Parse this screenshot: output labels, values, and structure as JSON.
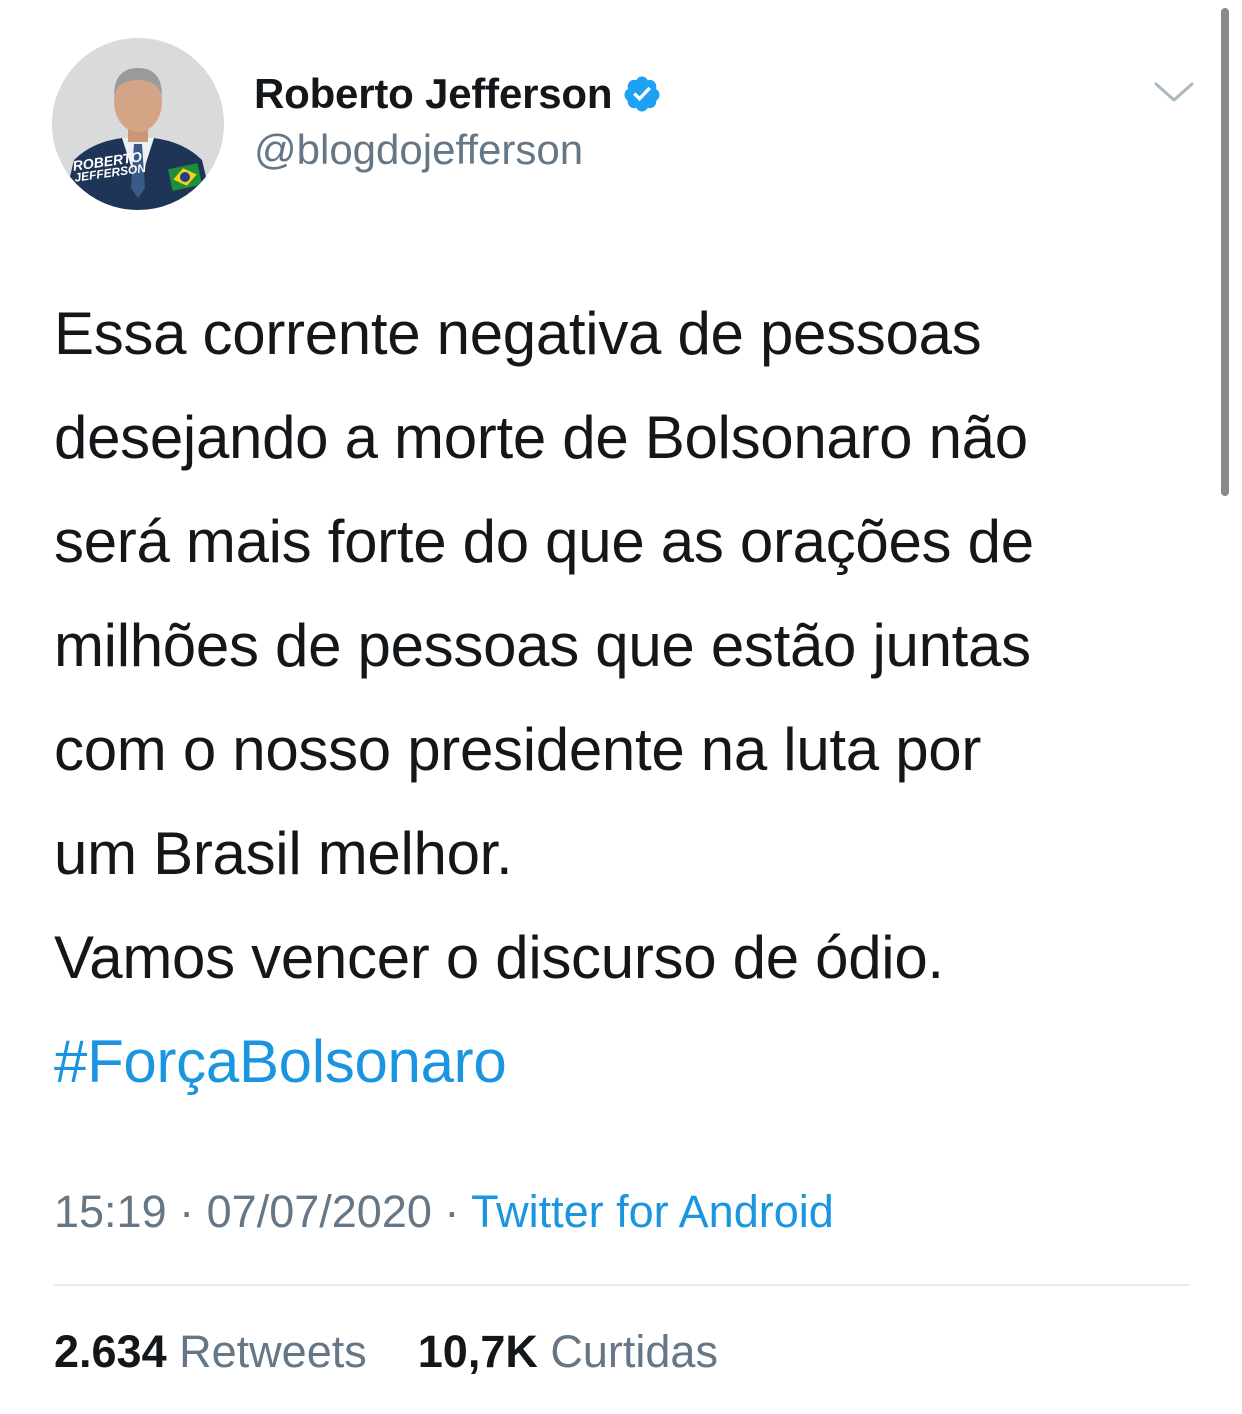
{
  "author": {
    "name": "Roberto Jefferson",
    "handle": "@blogdojefferson",
    "verified": true,
    "avatar_caption_line1": "ROBERTO",
    "avatar_caption_line2": "JEFFERSON"
  },
  "tweet": {
    "lines": [
      "Essa corrente negativa de pessoas",
      "desejando a morte de Bolsonaro não",
      "será mais forte do que as orações de",
      "milhões de pessoas que estão juntas",
      "com o nosso presidente na luta por",
      "um Brasil melhor.",
      "Vamos vencer o discurso de ódio."
    ],
    "hashtag": "#ForçaBolsonaro"
  },
  "meta": {
    "time": "15:19",
    "separator": "·",
    "date": "07/07/2020",
    "source": "Twitter for Android"
  },
  "stats": {
    "retweets_count": "2.634",
    "retweets_label": "Retweets",
    "likes_count": "10,7K",
    "likes_label": "Curtidas"
  },
  "icons": {
    "verified": "verified-badge-icon",
    "caret": "chevron-down-icon"
  },
  "colors": {
    "link": "#1b95e0",
    "secondary_text": "#657786",
    "primary_text": "#14171a",
    "verified": "#1da1f2"
  }
}
